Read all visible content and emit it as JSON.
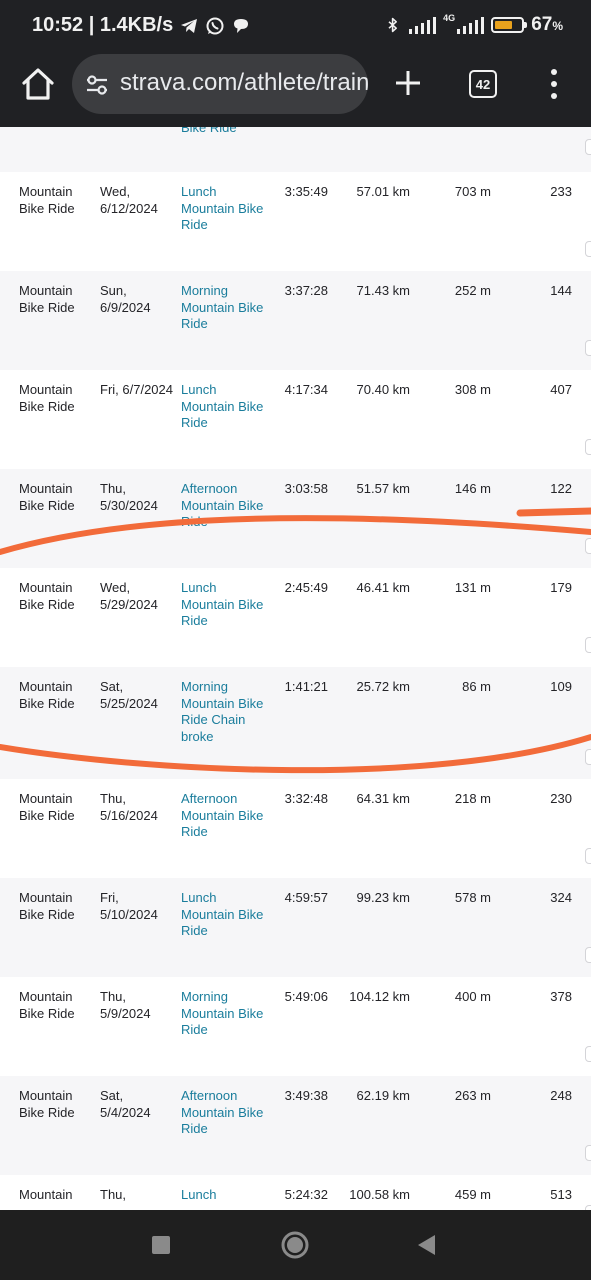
{
  "status_bar": {
    "time_speed": "10:52 | 1.4KB/s",
    "network": "4G",
    "battery_level": 0.67,
    "battery_text": "67",
    "battery_unit": "%"
  },
  "browser": {
    "url": "strava.com/athlete/training",
    "tab_count": "42"
  },
  "table": {
    "partial_top": {
      "title_tail": "Bike Ride"
    },
    "rows": [
      {
        "type": "Mountain Bike Ride",
        "date": "Wed, 6/12/2024",
        "title": "Lunch Mountain Bike Ride",
        "time": "3:35:49",
        "distance": "57.01 km",
        "elevation": "703 m",
        "suffer": "233"
      },
      {
        "type": "Mountain Bike Ride",
        "date": "Sun, 6/9/2024",
        "title": "Morning Mountain Bike Ride",
        "time": "3:37:28",
        "distance": "71.43 km",
        "elevation": "252 m",
        "suffer": "144"
      },
      {
        "type": "Mountain Bike Ride",
        "date": "Fri, 6/7/2024",
        "title": "Lunch Mountain Bike Ride",
        "time": "4:17:34",
        "distance": "70.40 km",
        "elevation": "308 m",
        "suffer": "407"
      },
      {
        "type": "Mountain Bike Ride",
        "date": "Thu, 5/30/2024",
        "title": "Afternoon Mountain Bike Ride",
        "time": "3:03:58",
        "distance": "51.57 km",
        "elevation": "146 m",
        "suffer": "122"
      },
      {
        "type": "Mountain Bike Ride",
        "date": "Wed, 5/29/2024",
        "title": "Lunch Mountain Bike Ride",
        "time": "2:45:49",
        "distance": "46.41 km",
        "elevation": "131 m",
        "suffer": "179"
      },
      {
        "type": "Mountain Bike Ride",
        "date": "Sat, 5/25/2024",
        "title": "Morning Mountain Bike Ride Chain broke",
        "time": "1:41:21",
        "distance": "25.72 km",
        "elevation": "86 m",
        "suffer": "109"
      },
      {
        "type": "Mountain Bike Ride",
        "date": "Thu, 5/16/2024",
        "title": "Afternoon Mountain Bike Ride",
        "time": "3:32:48",
        "distance": "64.31 km",
        "elevation": "218 m",
        "suffer": "230"
      },
      {
        "type": "Mountain Bike Ride",
        "date": "Fri, 5/10/2024",
        "title": "Lunch Mountain Bike Ride",
        "time": "4:59:57",
        "distance": "99.23 km",
        "elevation": "578 m",
        "suffer": "324"
      },
      {
        "type": "Mountain Bike Ride",
        "date": "Thu, 5/9/2024",
        "title": "Morning Mountain Bike Ride",
        "time": "5:49:06",
        "distance": "104.12 km",
        "elevation": "400 m",
        "suffer": "378"
      },
      {
        "type": "Mountain Bike Ride",
        "date": "Sat, 5/4/2024",
        "title": "Afternoon Mountain Bike Ride",
        "time": "3:49:38",
        "distance": "62.19 km",
        "elevation": "263 m",
        "suffer": "248"
      },
      {
        "type": "Mountain",
        "date": "Thu,",
        "title": "Lunch",
        "time": "5:24:32",
        "distance": "100.58 km",
        "elevation": "459 m",
        "suffer": "513"
      }
    ]
  },
  "annotation": {
    "color": "#f26b3a"
  },
  "colors": {
    "link": "#1a7d9c",
    "chrome": "#202124",
    "row_alt": "#f6f6f8"
  },
  "nav_bar": {
    "icons": [
      "recents-square-icon",
      "home-circle-icon",
      "back-triangle-icon"
    ]
  }
}
